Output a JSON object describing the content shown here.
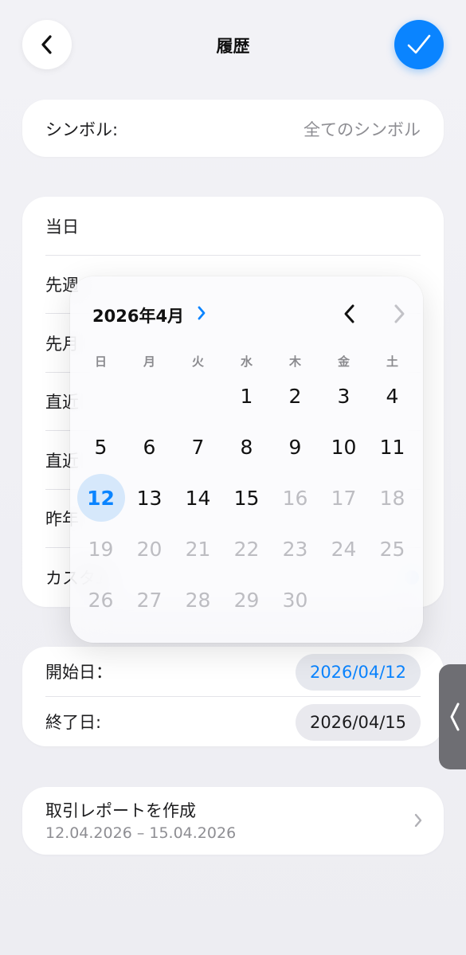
{
  "header": {
    "title": "履歴",
    "back_icon": "chevron-left-icon",
    "confirm_icon": "checkmark-icon",
    "accent_color": "#0a84ff"
  },
  "symbol": {
    "label": "シンボル:",
    "value": "全てのシンボル"
  },
  "periods": [
    {
      "label": "当日"
    },
    {
      "label": "先週"
    },
    {
      "label": "先月"
    },
    {
      "label": "直近"
    },
    {
      "label": "直近"
    },
    {
      "label": "昨年"
    },
    {
      "label": "カスタム"
    }
  ],
  "calendar": {
    "month_title": "2026年4月",
    "weekdays": [
      "日",
      "月",
      "火",
      "水",
      "木",
      "金",
      "土"
    ],
    "weeks": [
      [
        "",
        "",
        "",
        "1",
        "2",
        "3",
        "4"
      ],
      [
        "5",
        "6",
        "7",
        "8",
        "9",
        "10",
        "11"
      ],
      [
        "12",
        "13",
        "14",
        "15",
        "16",
        "17",
        "18"
      ],
      [
        "19",
        "20",
        "21",
        "22",
        "23",
        "24",
        "25"
      ],
      [
        "26",
        "27",
        "28",
        "29",
        "30",
        "",
        ""
      ]
    ],
    "selected_day": "12",
    "last_enabled_day": 15
  },
  "dates": {
    "start_label": "開始日：",
    "start_value": "2026/04/12",
    "end_label": "終了日:",
    "end_value": "2026/04/15"
  },
  "report": {
    "title": "取引レポートを作成",
    "range": "12.04.2026 – 15.04.2026",
    "chevron_icon": "chevron-right-icon"
  },
  "side_handle": {
    "icon": "chevron-left-icon"
  }
}
